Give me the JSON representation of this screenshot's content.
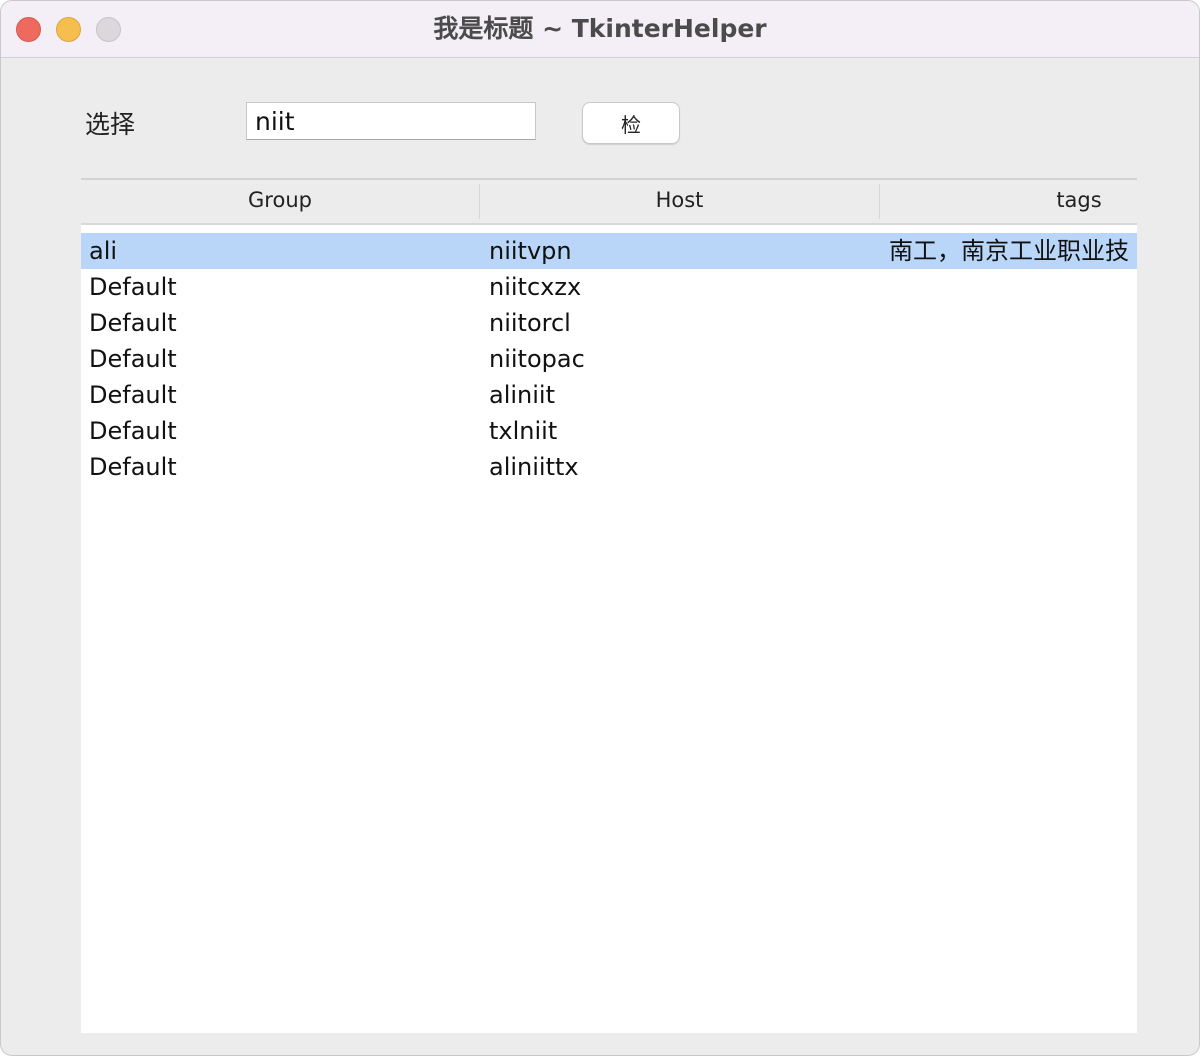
{
  "window": {
    "title": "我是标题 ~ TkinterHelper"
  },
  "form": {
    "select_label": "选择",
    "search_value": "niit",
    "search_button_label": "检"
  },
  "table": {
    "columns": [
      "Group",
      "Host",
      "tags"
    ],
    "rows": [
      {
        "group": "ali",
        "host": "niitvpn",
        "tags": "南工，南京工业职业技"
      },
      {
        "group": "Default",
        "host": "niitcxzx",
        "tags": ""
      },
      {
        "group": "Default",
        "host": "niitorcl",
        "tags": ""
      },
      {
        "group": "Default",
        "host": "niitopac",
        "tags": ""
      },
      {
        "group": "Default",
        "host": "aliniit",
        "tags": ""
      },
      {
        "group": "Default",
        "host": "txlniit",
        "tags": ""
      },
      {
        "group": "Default",
        "host": "aliniittx",
        "tags": ""
      }
    ],
    "selected_row": 0
  },
  "colors": {
    "selection": "#b9d6f9",
    "close": "#ee6a5f",
    "minimize": "#f5be4f",
    "zoom": "#dbd7dc"
  }
}
